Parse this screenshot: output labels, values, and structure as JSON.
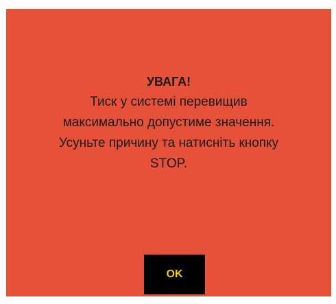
{
  "dialog": {
    "title": "УВАГА!",
    "message_lines": [
      "Тиск у системі перевищив",
      "максимально допустиме значення.",
      "Усуньте причину та натисніть кнопку",
      "STOP."
    ],
    "ok_label": "OK"
  },
  "colors": {
    "panel_background": "#e7513a",
    "text": "#1a1a1a",
    "button_background": "#000000",
    "button_text": "#f0d000"
  }
}
